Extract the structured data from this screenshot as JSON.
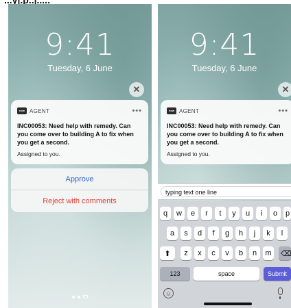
{
  "header": {
    "text": "...y|.p..|....."
  },
  "lockscreen": {
    "time": "9:41",
    "date": "Tuesday, 6 June"
  },
  "notification": {
    "close_symbol": "✕",
    "app_icon_text": "now",
    "app_name": "AGENT",
    "more_symbol": "•••",
    "title": "INC00053:  Need help with remedy.  Can you come over to building A to fix when you get a second.",
    "body": "Assigned to you."
  },
  "actions": {
    "approve": "Approve",
    "reject": "Reject with comments"
  },
  "reply": {
    "input_value": "typing text one line"
  },
  "keyboard": {
    "row1": [
      "q",
      "w",
      "e",
      "r",
      "t",
      "y",
      "u",
      "i",
      "o",
      "p"
    ],
    "row2": [
      "a",
      "s",
      "d",
      "f",
      "g",
      "h",
      "j",
      "k",
      "l"
    ],
    "row3": [
      "z",
      "x",
      "c",
      "v",
      "b",
      "n",
      "m"
    ],
    "shift_symbol": "⬆",
    "delete_symbol": "⌫",
    "numbers_label": "123",
    "space_label": "space",
    "submit_label": "Submit",
    "emoji_symbol": "☺"
  },
  "icons": [
    "close-icon",
    "app-icon",
    "more-icon",
    "shift-icon",
    "delete-icon",
    "emoji-icon",
    "microphone-icon",
    "camera-icon"
  ],
  "colors": {
    "approve": "#2e66c8",
    "reject": "#e0423a",
    "submit": "#5b5ed6"
  }
}
